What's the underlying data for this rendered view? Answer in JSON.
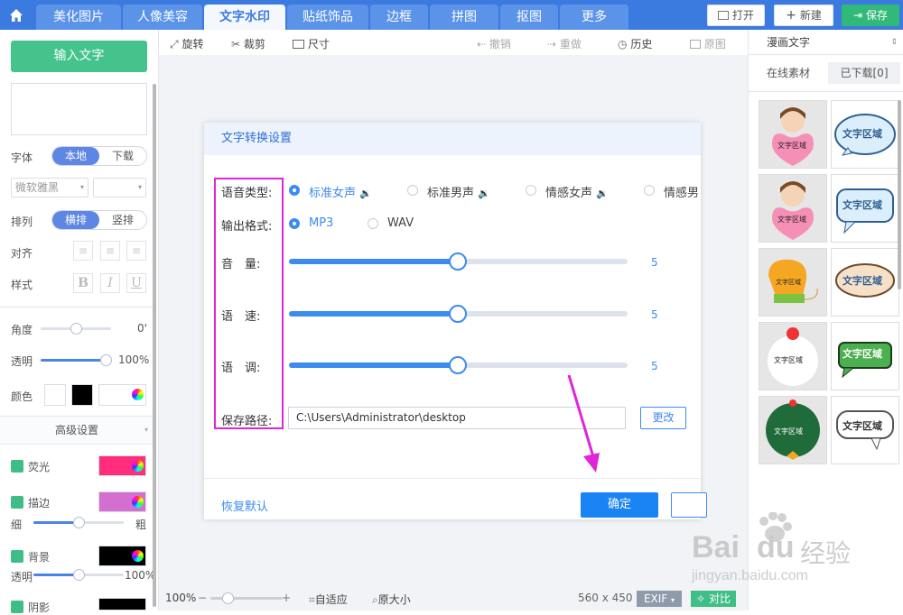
{
  "topbar": {
    "tabs": [
      {
        "label": "美化图片"
      },
      {
        "label": "人像美容"
      },
      {
        "label": "文字水印"
      },
      {
        "label": "贴纸饰品"
      },
      {
        "label": "边框"
      },
      {
        "label": "拼图"
      },
      {
        "label": "抠图"
      },
      {
        "label": "更多"
      }
    ],
    "active_tab": "文字水印",
    "open_label": "打开",
    "new_label": "新建",
    "save_label": "保存"
  },
  "left_panel": {
    "input_text_button": "输入文字",
    "font_label": "字体",
    "font_source": [
      "本地",
      "下载"
    ],
    "font_name": "微软雅黑",
    "arrange_label": "排列",
    "arrange_options": [
      "横排",
      "竖排"
    ],
    "align_label": "对齐",
    "style_label": "样式",
    "style_buttons": [
      "B",
      "I",
      "U"
    ],
    "angle_label": "角度",
    "angle_value": "0'",
    "opacity_label": "透明",
    "opacity_value": "100%",
    "opacity_level": 1.0,
    "color_label": "颜色",
    "advanced_label": "高级设置",
    "glow_label": "荧光",
    "glow_color": "#ff2d7c",
    "stroke_label": "描边",
    "stroke_color": "#d36fd0",
    "thin_label": "细",
    "thick_label": "粗",
    "bg_label": "背景",
    "bg_color": "#000000",
    "bg_opacity_label": "透明",
    "bg_opacity_value": "100%",
    "shadow_label": "阴影"
  },
  "toolbar": {
    "rotate": "旋转",
    "crop": "裁剪",
    "size": "尺寸",
    "undo": "撤销",
    "redo": "重做",
    "history": "历史",
    "original": "原图"
  },
  "dialog": {
    "title": "文字转换设置",
    "voice_type_label": "语音类型:",
    "voice_options": [
      "标准女声",
      "标准男声",
      "情感女声",
      "情感男"
    ],
    "voice_selected": "标准女声",
    "output_format_label": "输出格式:",
    "format_options": [
      "MP3",
      "WAV"
    ],
    "format_selected": "MP3",
    "volume_label": "音　量:",
    "volume_value": "5",
    "speed_label": "语　速:",
    "speed_value": "5",
    "pitch_label": "语　调:",
    "pitch_value": "5",
    "save_path_label": "保存路径:",
    "save_path": "C:\\Users\\Administrator\\desktop",
    "change_button": "更改",
    "reset_link": "恢复默认",
    "ok_button": "确定",
    "accent_color": "#3c8bf0"
  },
  "statusbar": {
    "zoom": "100%",
    "fit": "自适应",
    "original_size": "原大小",
    "dimensions": "560 x 450",
    "exif": "EXIF",
    "compare": "对比"
  },
  "right_panel": {
    "category": "漫画文字",
    "tabs": [
      "在线素材",
      "已下载[0]"
    ],
    "sticker_text": "文字区域"
  },
  "watermark": {
    "brand": "Bai",
    "brand2": "du",
    "cn": "经验",
    "url": "jingyan.baidu.com"
  }
}
